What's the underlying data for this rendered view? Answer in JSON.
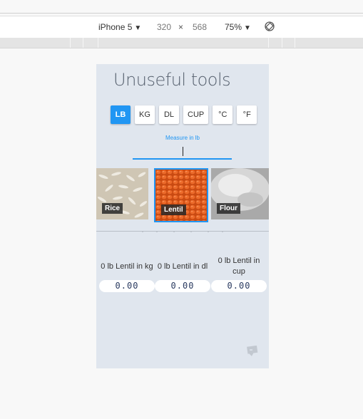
{
  "devtools": {
    "device": "iPhone 5",
    "width": "320",
    "times": "×",
    "height": "568",
    "zoom": "75%"
  },
  "app": {
    "title": "Unuseful tools",
    "units": [
      "LB",
      "KG",
      "DL",
      "CUP",
      "°C",
      "°F"
    ],
    "active_unit": "LB",
    "measure_label": "Measure in lb",
    "measure_value": "",
    "ingredients": [
      "Rice",
      "Lentil",
      "Flour"
    ],
    "selected_ingredient": "Lentil",
    "results": [
      {
        "title": "0 lb Lentil in kg",
        "value": "0.00"
      },
      {
        "title": "0 lb Lentil in dl",
        "value": "0.00"
      },
      {
        "title": "0 lb Lentil in cup",
        "value": "0.00"
      }
    ]
  },
  "colors": {
    "accent": "#2196f3",
    "panel": "#e0e6ee",
    "lentil": "#d9581a"
  },
  "icons": [
    "caret-down-icon",
    "rotate-icon",
    "feedback-icon"
  ]
}
